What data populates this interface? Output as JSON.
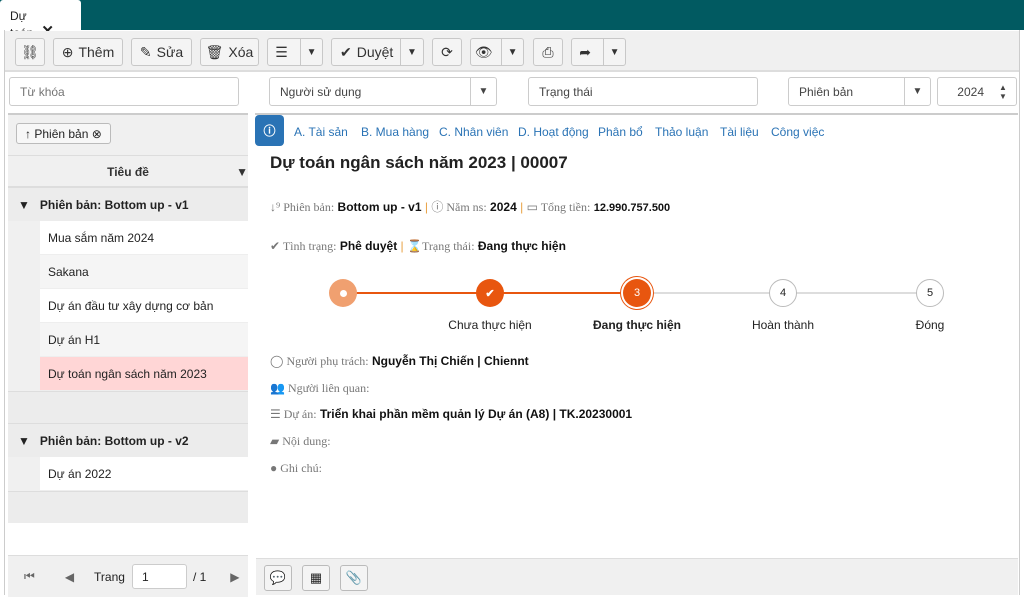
{
  "tab": {
    "title": "Dự toán"
  },
  "toolbar": {
    "add": "Thêm",
    "edit": "Sửa",
    "delete": "Xóa",
    "approve": "Duyệt"
  },
  "filters": {
    "keyword_placeholder": "Từ khóa",
    "user": "Người sử dụng",
    "status": "Trạng thái",
    "version": "Phiên bản",
    "year": "2024"
  },
  "left": {
    "chip": "Phiên bản",
    "column": "Tiêu đề",
    "groups": [
      {
        "label": "Phiên bản: Bottom up - v1",
        "items": [
          "Mua sắm năm 2024",
          "Sakana",
          "Dự án đầu tư xây dựng cơ bản",
          "Dự án H1",
          "Dự toán ngân sách năm 2023"
        ]
      },
      {
        "label": "Phiên bản: Bottom up - v2",
        "items": [
          "Dự án 2022"
        ]
      }
    ],
    "pager": {
      "label": "Trang",
      "page": "1",
      "total": "/ 1"
    }
  },
  "tabs": [
    "A. Tài sản",
    "B. Mua hàng",
    "C. Nhân viên",
    "D. Hoạt động",
    "Phân bổ",
    "Thảo luận",
    "Tài liệu",
    "Công việc"
  ],
  "detail": {
    "title": "Dự toán ngân sách năm 2023 | 00007",
    "version_label": "Phiên bản:",
    "version": "Bottom up - v1",
    "year_label": "Năm ns:",
    "year": "2024",
    "total_label": "Tổng tiền:",
    "total": "12.990.757.500",
    "cond_label": "Tình trạng:",
    "cond": "Phê duyệt",
    "state_label": "Trạng thái:",
    "state": "Đang thực hiện",
    "owner_label": "Người phụ trách:",
    "owner": "Nguyễn Thị Chiến | Chiennt",
    "related_label": "Người liên quan:",
    "project_label": "Dự án:",
    "project": "Triển khai phần mềm quản lý Dự án (A8) | TK.20230001",
    "content_label": "Nội dung:",
    "note_label": "Ghi chú:"
  },
  "steps": [
    {
      "num": "",
      "label": ""
    },
    {
      "num": "",
      "label": "Chưa thực hiện"
    },
    {
      "num": "3",
      "label": "Đang thực hiện"
    },
    {
      "num": "4",
      "label": "Hoàn thành"
    },
    {
      "num": "5",
      "label": "Đóng"
    }
  ],
  "current_step": 3,
  "colors": {
    "header": "#015a61",
    "accent": "#e8560f",
    "link": "#2a73b5",
    "selected_row": "#ffd6d6"
  }
}
